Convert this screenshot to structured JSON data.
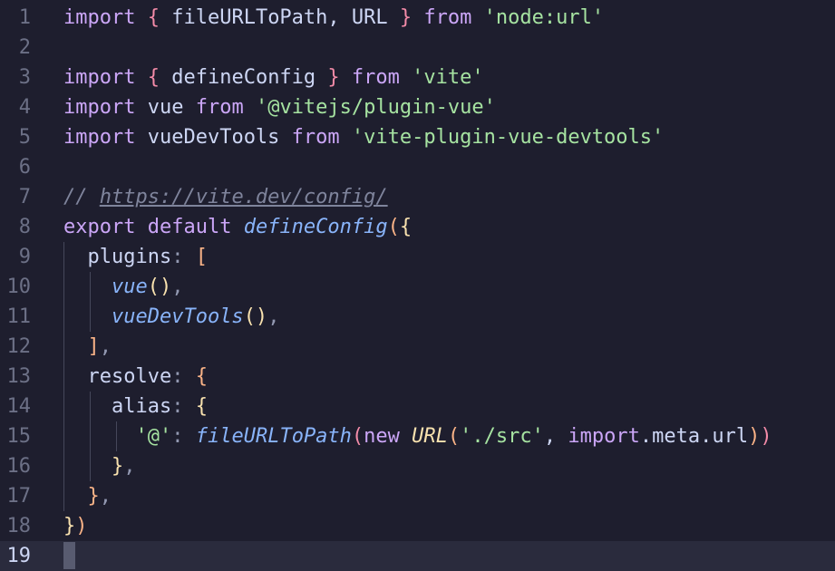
{
  "editor": {
    "line_numbers": [
      "1",
      "2",
      "3",
      "4",
      "5",
      "6",
      "7",
      "8",
      "9",
      "10",
      "11",
      "12",
      "13",
      "14",
      "15",
      "16",
      "17",
      "18",
      "19"
    ],
    "current_line": "19",
    "lines": [
      [
        {
          "t": "import",
          "c": "kw"
        },
        {
          "t": " "
        },
        {
          "t": "{",
          "c": "br1"
        },
        {
          "t": " fileURLToPath, URL "
        },
        {
          "t": "}",
          "c": "br1"
        },
        {
          "t": " "
        },
        {
          "t": "from",
          "c": "kw"
        },
        {
          "t": " "
        },
        {
          "t": "'node:url'",
          "c": "str"
        }
      ],
      [],
      [
        {
          "t": "import",
          "c": "kw"
        },
        {
          "t": " "
        },
        {
          "t": "{",
          "c": "br1"
        },
        {
          "t": " defineConfig "
        },
        {
          "t": "}",
          "c": "br1"
        },
        {
          "t": " "
        },
        {
          "t": "from",
          "c": "kw"
        },
        {
          "t": " "
        },
        {
          "t": "'vite'",
          "c": "str"
        }
      ],
      [
        {
          "t": "import",
          "c": "kw"
        },
        {
          "t": " vue "
        },
        {
          "t": "from",
          "c": "kw"
        },
        {
          "t": " "
        },
        {
          "t": "'@vitejs/plugin-vue'",
          "c": "str"
        }
      ],
      [
        {
          "t": "import",
          "c": "kw"
        },
        {
          "t": " vueDevTools "
        },
        {
          "t": "from",
          "c": "kw"
        },
        {
          "t": " "
        },
        {
          "t": "'vite-plugin-vue-devtools'",
          "c": "str"
        }
      ],
      [],
      [
        {
          "t": "// ",
          "c": "cmt"
        },
        {
          "t": "https://vite.dev/config/",
          "c": "cmt url"
        }
      ],
      [
        {
          "t": "export",
          "c": "kw"
        },
        {
          "t": " "
        },
        {
          "t": "default",
          "c": "kw"
        },
        {
          "t": " "
        },
        {
          "t": "defineConfig",
          "c": "fn"
        },
        {
          "t": "(",
          "c": "br2"
        },
        {
          "t": "{",
          "c": "br3"
        }
      ],
      [
        {
          "t": "  plugins"
        },
        {
          "t": ":",
          "c": "punc"
        },
        {
          "t": " "
        },
        {
          "t": "[",
          "c": "br2"
        }
      ],
      [
        {
          "t": "    "
        },
        {
          "t": "vue",
          "c": "fn"
        },
        {
          "t": "()",
          "c": "br3"
        },
        {
          "t": ",",
          "c": "punc"
        }
      ],
      [
        {
          "t": "    "
        },
        {
          "t": "vueDevTools",
          "c": "fn"
        },
        {
          "t": "()",
          "c": "br3"
        },
        {
          "t": ",",
          "c": "punc"
        }
      ],
      [
        {
          "t": "  "
        },
        {
          "t": "]",
          "c": "br2"
        },
        {
          "t": ",",
          "c": "punc"
        }
      ],
      [
        {
          "t": "  resolve"
        },
        {
          "t": ":",
          "c": "punc"
        },
        {
          "t": " "
        },
        {
          "t": "{",
          "c": "br2"
        }
      ],
      [
        {
          "t": "    alias"
        },
        {
          "t": ":",
          "c": "punc"
        },
        {
          "t": " "
        },
        {
          "t": "{",
          "c": "br3"
        }
      ],
      [
        {
          "t": "      "
        },
        {
          "t": "'@'",
          "c": "str"
        },
        {
          "t": ":",
          "c": "punc"
        },
        {
          "t": " "
        },
        {
          "t": "fileURLToPath",
          "c": "fn"
        },
        {
          "t": "(",
          "c": "br1"
        },
        {
          "t": "new",
          "c": "kw"
        },
        {
          "t": " "
        },
        {
          "t": "URL",
          "c": "cls"
        },
        {
          "t": "(",
          "c": "br2"
        },
        {
          "t": "'./src'",
          "c": "str"
        },
        {
          "t": ", "
        },
        {
          "t": "import",
          "c": "meta"
        },
        {
          "t": ".meta.url"
        },
        {
          "t": ")",
          "c": "br2"
        },
        {
          "t": ")",
          "c": "br1"
        }
      ],
      [
        {
          "t": "    "
        },
        {
          "t": "}",
          "c": "br3"
        },
        {
          "t": ",",
          "c": "punc"
        }
      ],
      [
        {
          "t": "  "
        },
        {
          "t": "}",
          "c": "br2"
        },
        {
          "t": ",",
          "c": "punc"
        }
      ],
      [
        {
          "t": "}",
          "c": "br3"
        },
        {
          "t": ")",
          "c": "br2"
        }
      ],
      []
    ]
  },
  "colors": {
    "background": "#1e1e2e",
    "current_line_bg": "#2a2b3d",
    "keyword": "#cba6f7",
    "string": "#a6e3a1",
    "function": "#89b4fa",
    "comment": "#7f849c"
  }
}
